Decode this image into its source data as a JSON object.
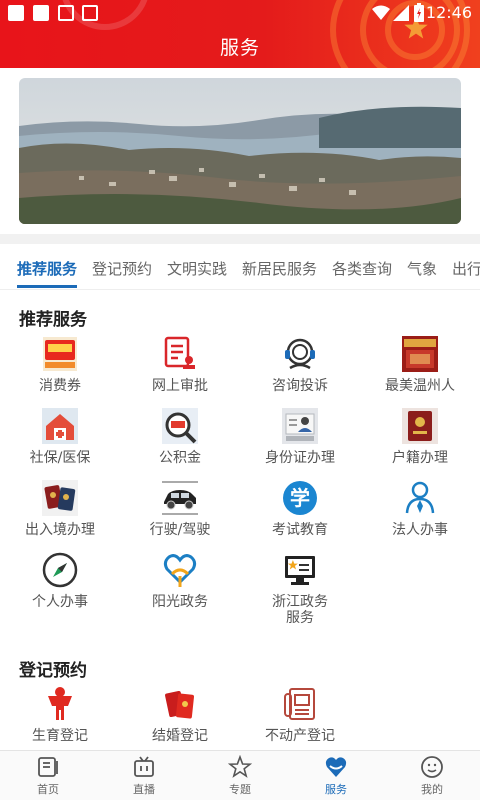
{
  "status_bar": {
    "time": "12:46"
  },
  "header": {
    "title": "服务"
  },
  "tabs": [
    "推荐服务",
    "登记预约",
    "文明实践",
    "新居民服务",
    "各类查询",
    "气象",
    "出行"
  ],
  "recommended": {
    "title": "推荐服务",
    "items": [
      {
        "label": "消费券",
        "icon": "coupon-icon"
      },
      {
        "label": "网上审批",
        "icon": "approval-icon"
      },
      {
        "label": "咨询投诉",
        "icon": "headset-icon"
      },
      {
        "label": "最美温州人",
        "icon": "wenzhou-people-icon"
      },
      {
        "label": "社保/医保",
        "icon": "insurance-icon"
      },
      {
        "label": "公积金",
        "icon": "housing-fund-icon"
      },
      {
        "label": "身份证办理",
        "icon": "id-card-icon"
      },
      {
        "label": "户籍办理",
        "icon": "household-register-icon"
      },
      {
        "label": "出入境办理",
        "icon": "passport-icon"
      },
      {
        "label": "行驶/驾驶",
        "icon": "car-icon"
      },
      {
        "label": "考试教育",
        "icon": "education-icon"
      },
      {
        "label": "法人办事",
        "icon": "legal-person-icon"
      },
      {
        "label": "个人办事",
        "icon": "compass-icon"
      },
      {
        "label": "阳光政务",
        "icon": "sunshine-gov-icon"
      },
      {
        "label": "浙江政务服务",
        "label_lines": [
          "浙江政务",
          "服务"
        ],
        "icon": "zhejiang-gov-icon"
      }
    ]
  },
  "registration": {
    "title": "登记预约",
    "items": [
      {
        "label": "生育登记",
        "icon": "birth-register-icon"
      },
      {
        "label": "结婚登记",
        "icon": "marriage-register-icon"
      },
      {
        "label": "不动产登记",
        "icon": "real-estate-icon"
      }
    ]
  },
  "bottom_nav": [
    {
      "label": "首页",
      "icon": "home-icon",
      "active": false
    },
    {
      "label": "直播",
      "icon": "live-tv-icon",
      "active": false
    },
    {
      "label": "专题",
      "icon": "star-icon",
      "active": false
    },
    {
      "label": "服务",
      "icon": "service-heart-icon",
      "active": true
    },
    {
      "label": "我的",
      "icon": "profile-smile-icon",
      "active": false
    }
  ],
  "colors": {
    "header_red": "#e8141a",
    "accent_blue": "#1c6bb8"
  }
}
